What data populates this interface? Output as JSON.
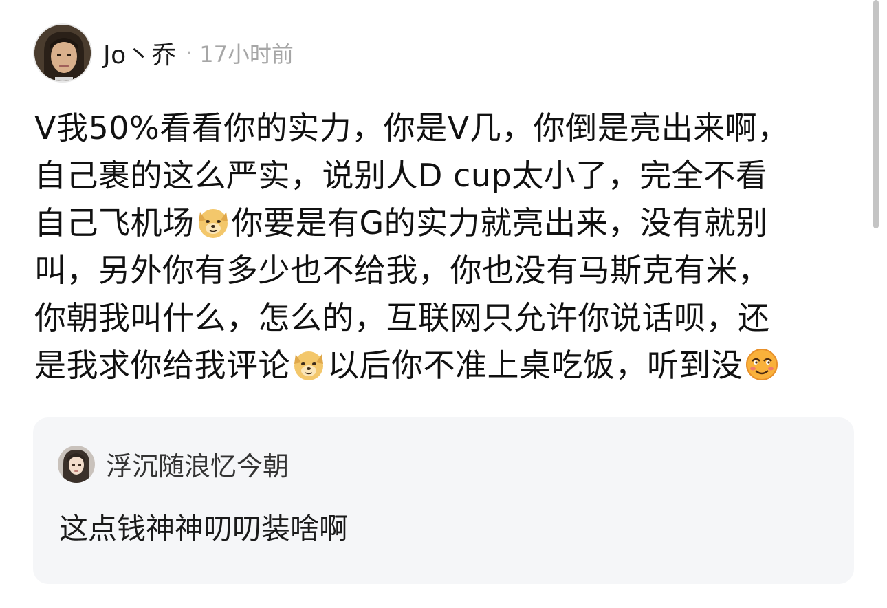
{
  "post": {
    "username": "Jo丶乔",
    "separator": "·",
    "timestamp": "17小时前",
    "lines": [
      "V我50%看看你的实力，你是V几，你倒是亮出来啊，",
      "自己裹的这么严实，说别人D cup太小了，完全不看",
      [
        "自己飞机场",
        "你要是有G的实力就亮出来，没有就别"
      ],
      "叫，另外你有多少也不给我，你也没有马斯克有米，",
      "你朝我叫什么，怎么的，互联网只允许你说话呗，还",
      [
        "是我求你给我评论",
        "以后你不准上桌吃饭，听到没"
      ]
    ],
    "l3a": "自己飞机场",
    "l3b": "你要是有G的实力就亮出来，没有就别",
    "l6a": "是我求你给我评论",
    "l6b": "以后你不准上桌吃饭，听到没",
    "emojis": [
      "doge-emoji",
      "doge-emoji",
      "smirk-emoji"
    ]
  },
  "quote": {
    "username": "浮沉随浪忆今朝",
    "text": "这点钱神神叨叨装啥啊"
  },
  "colors": {
    "card_bg": "#f5f6f8",
    "muted": "#a6a6a6"
  }
}
